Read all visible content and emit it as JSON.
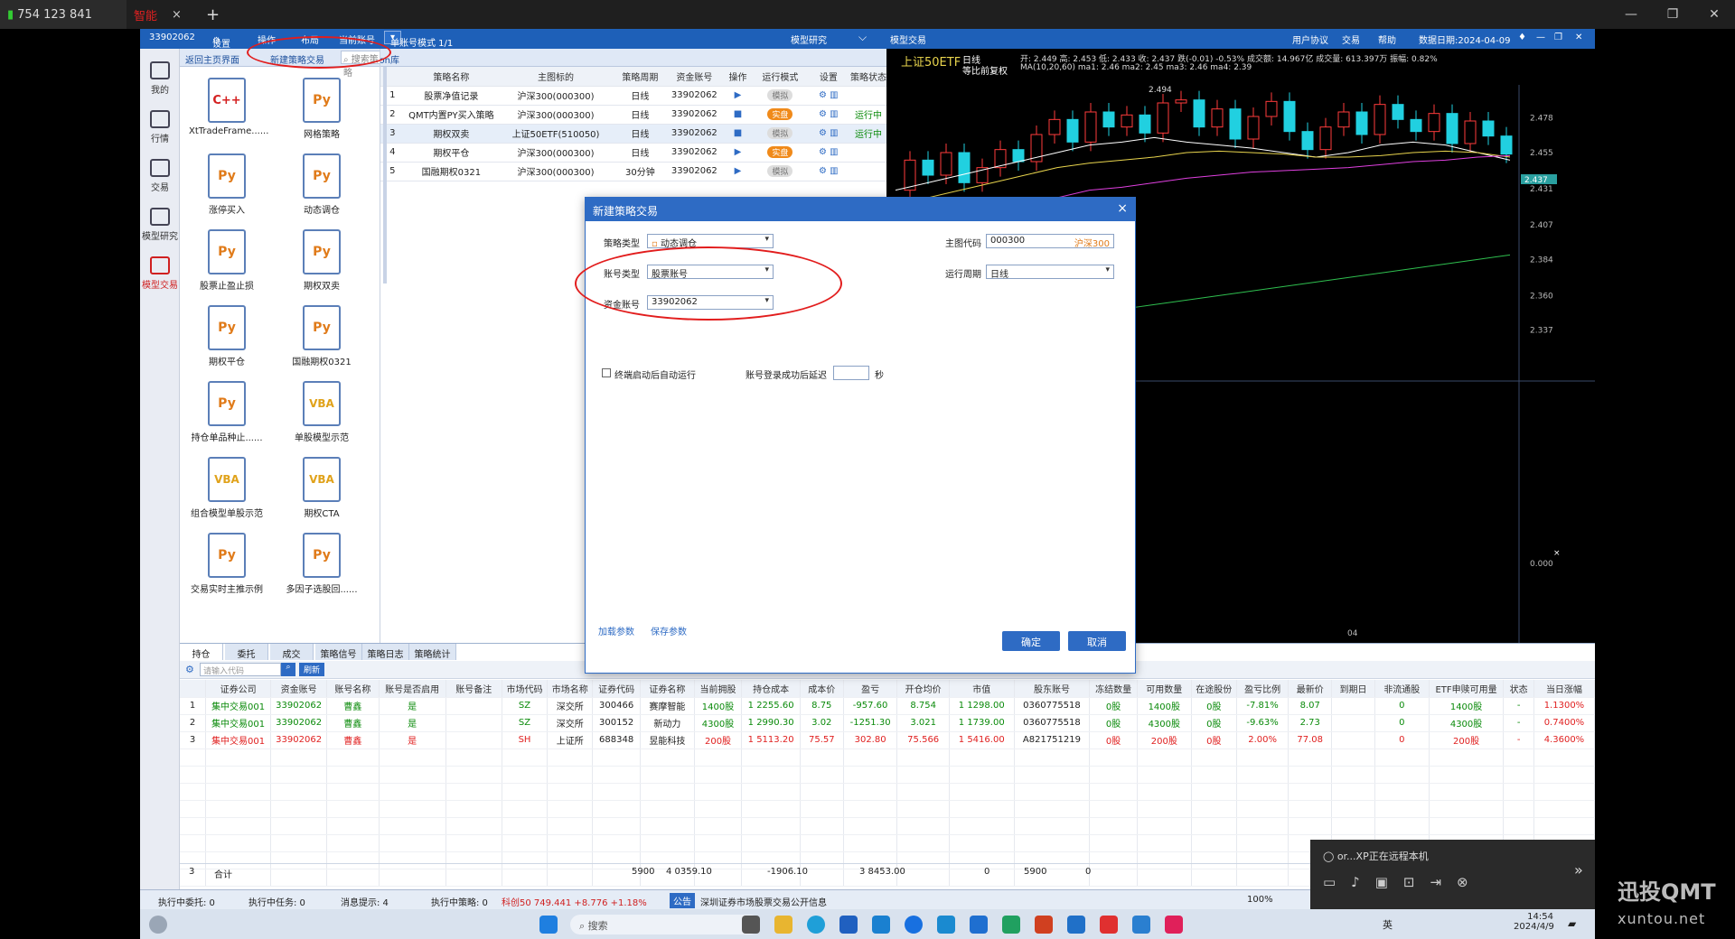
{
  "browser": {
    "tab1_label": "754 123 841",
    "tab2_label": "智能",
    "new_tab": "+"
  },
  "app": {
    "account_id": "33902062",
    "menu": [
      "设置",
      "操作",
      "布局",
      "当前账号"
    ],
    "account_mode": "单账号模式 1/1",
    "model_research": "模型研究",
    "model_trading": "模型交易",
    "user_agreement": "用户协议",
    "trade": "交易",
    "help": "帮助",
    "data_date": "数据日期:2024-04-09"
  },
  "left_nav": [
    {
      "label": "我的",
      "icon": "home-icon"
    },
    {
      "label": "行情",
      "icon": "chart-icon"
    },
    {
      "label": "交易",
      "icon": "trade-icon"
    },
    {
      "label": "模型研究",
      "icon": "model-research-icon"
    },
    {
      "label": "模型交易",
      "icon": "model-trading-icon"
    }
  ],
  "strategy_tabs": {
    "back_home": "返回主页界面",
    "new_strategy": "新建策略交易",
    "search_placeholder": "搜索策略",
    "download": "下载python库"
  },
  "strategy_files": [
    {
      "name": "XtTradeFrame......",
      "type": "C++"
    },
    {
      "name": "网格策略",
      "type": "Py"
    },
    {
      "name": "涨停买入",
      "type": "Py"
    },
    {
      "name": "动态调仓",
      "type": "Py"
    },
    {
      "name": "股票止盈止损",
      "type": "Py"
    },
    {
      "name": "期权双卖",
      "type": "Py"
    },
    {
      "name": "期权平仓",
      "type": "Py"
    },
    {
      "name": "国融期权0321",
      "type": "Py"
    },
    {
      "name": "持仓单品种止......",
      "type": "Py"
    },
    {
      "name": "单股模型示范",
      "type": "VBA"
    },
    {
      "name": "组合模型单股示范",
      "type": "VBA"
    },
    {
      "name": "期权CTA",
      "type": "VBA"
    },
    {
      "name": "交易实时主推示例",
      "type": "Py"
    },
    {
      "name": "多因子选股回......",
      "type": "Py"
    }
  ],
  "strategy_table": {
    "headers": [
      "",
      "策略名称",
      "主图标的",
      "策略周期",
      "资金账号",
      "操作",
      "运行模式",
      "设置",
      "策略状态"
    ],
    "rows": [
      {
        "idx": "1",
        "name": "股票净值记录",
        "target": "沪深300(000300)",
        "period": "日线",
        "account": "33902062",
        "op": "▶",
        "mode": "模拟",
        "status": ""
      },
      {
        "idx": "2",
        "name": "QMT内置PY买入策略",
        "target": "沪深300(000300)",
        "period": "日线",
        "account": "33902062",
        "op": "■",
        "mode": "实盘",
        "status": "运行中"
      },
      {
        "idx": "3",
        "name": "期权双卖",
        "target": "上证50ETF(510050)",
        "period": "日线",
        "account": "33902062",
        "op": "■",
        "mode": "模拟",
        "status": "运行中"
      },
      {
        "idx": "4",
        "name": "期权平仓",
        "target": "沪深300(000300)",
        "period": "日线",
        "account": "33902062",
        "op": "▶",
        "mode": "实盘",
        "status": ""
      },
      {
        "idx": "5",
        "name": "国融期权0321",
        "target": "沪深300(000300)",
        "period": "30分钟",
        "account": "33902062",
        "op": "▶",
        "mode": "模拟",
        "status": ""
      }
    ]
  },
  "chart": {
    "symbol": "上证50ETF",
    "period": "日线",
    "adjust": "等比前复权",
    "ohlc_text": "开: 2.449  高: 2.453  低: 2.433  收: 2.437  跌(-0.01)  -0.53%  成交额: 14.967亿  成交量: 613.397万  振幅: 0.82%",
    "ma_text": "MA(10,20,60)  ma1: 2.46  ma2: 2.45  ma3: 2.46  ma4: 2.39",
    "price_labels": [
      "2.478",
      "2.455",
      "2.431",
      "2.407",
      "2.384",
      "2.360",
      "2.337",
      "0.000"
    ],
    "high_label": "2.494",
    "current_price": "2.437",
    "x_label": "04"
  },
  "chart_data": {
    "type": "line",
    "title": "上证50ETF",
    "series": [
      {
        "name": "ma1",
        "color": "#ffffff",
        "values": [
          2.43,
          2.435,
          2.44,
          2.445,
          2.45,
          2.455,
          2.46,
          2.462,
          2.465,
          2.462,
          2.46,
          2.458,
          2.455,
          2.452,
          2.455,
          2.46,
          2.462,
          2.46,
          2.455,
          2.45
        ]
      },
      {
        "name": "ma2",
        "color": "#e8d44d",
        "values": [
          2.42,
          2.425,
          2.43,
          2.435,
          2.44,
          2.445,
          2.448,
          2.45,
          2.452,
          2.455,
          2.456,
          2.455,
          2.454,
          2.452,
          2.452,
          2.453,
          2.455,
          2.456,
          2.455,
          2.452
        ]
      },
      {
        "name": "ma3",
        "color": "#e040e0",
        "values": [
          2.4,
          2.405,
          2.41,
          2.415,
          2.42,
          2.425,
          2.43,
          2.432,
          2.435,
          2.438,
          2.44,
          2.442,
          2.443,
          2.444,
          2.445,
          2.447,
          2.449,
          2.45,
          2.452,
          2.453
        ]
      },
      {
        "name": "ma4",
        "color": "#2fbf4f",
        "values": [
          2.33,
          2.333,
          2.336,
          2.339,
          2.342,
          2.345,
          2.348,
          2.351,
          2.354,
          2.357,
          2.36,
          2.363,
          2.366,
          2.369,
          2.372,
          2.375,
          2.378,
          2.381,
          2.384,
          2.387
        ]
      }
    ],
    "ylim": [
      2.32,
      2.5
    ]
  },
  "dialog": {
    "title": "新建策略交易",
    "strategy_type_label": "策略类型",
    "strategy_type_value": "动态调仓",
    "account_type_label": "账号类型",
    "account_type_value": "股票账号",
    "fund_account_label": "资金账号",
    "fund_account_value": "33902062",
    "main_code_label": "主图代码",
    "main_code_value": "000300",
    "main_code_name": "沪深300",
    "run_period_label": "运行周期",
    "run_period_value": "日线",
    "auto_run_label": "终端启动后自动运行",
    "login_delay_label": "账号登录成功后延迟",
    "login_delay_value": "",
    "seconds_label": "秒",
    "load_params": "加载参数",
    "save_params": "保存参数",
    "ok": "确定",
    "cancel": "取消",
    "close": "×"
  },
  "bottom_tabs": [
    "持仓",
    "委托",
    "成交",
    "策略信号",
    "策略日志",
    "策略统计"
  ],
  "bottom_search_placeholder": "请输入代码",
  "bottom_refresh": "刷新",
  "holdings_headers": [
    "",
    "证券公司",
    "资金账号",
    "账号名称",
    "账号是否启用",
    "账号备注",
    "市场代码",
    "市场名称",
    "证券代码",
    "证券名称",
    "当前拥股",
    "持仓成本",
    "成本价",
    "盈亏",
    "开仓均价",
    "市值",
    "股东账号",
    "冻结数量",
    "可用数量",
    "在途股份",
    "盈亏比例",
    "最新价",
    "到期日",
    "非流通股",
    "ETF申赎可用量",
    "状态",
    "当日涨幅"
  ],
  "holdings": [
    [
      "1",
      "集中交易001",
      "33902062",
      "曹鑫",
      "是",
      "",
      "SZ",
      "深交所",
      "300466",
      "赛摩智能",
      "1400股",
      "1 2255.60",
      "8.75",
      "-957.60",
      "8.754",
      "1 1298.00",
      "0360775518",
      "0股",
      "1400股",
      "0股",
      "-7.81%",
      "8.07",
      "",
      "0",
      "1400股",
      "-",
      "1.1300%"
    ],
    [
      "2",
      "集中交易001",
      "33902062",
      "曹鑫",
      "是",
      "",
      "SZ",
      "深交所",
      "300152",
      "新动力",
      "4300股",
      "1 2990.30",
      "3.02",
      "-1251.30",
      "3.021",
      "1 1739.00",
      "0360775518",
      "0股",
      "4300股",
      "0股",
      "-9.63%",
      "2.73",
      "",
      "0",
      "4300股",
      "-",
      "0.7400%"
    ],
    [
      "3",
      "集中交易001",
      "33902062",
      "曹鑫",
      "是",
      "",
      "SH",
      "上证所",
      "688348",
      "昱能科技",
      "200股",
      "1 5113.20",
      "75.57",
      "302.80",
      "75.566",
      "1 5416.00",
      "A821751219",
      "0股",
      "200股",
      "0股",
      "2.00%",
      "77.08",
      "",
      "0",
      "200股",
      "-",
      "4.3600%"
    ]
  ],
  "totals": {
    "count": "3",
    "label": "合计",
    "hold": "5900",
    "cost": "4 0359.10",
    "pnl": "-1906.10",
    "value": "3 8453.00",
    "frozen": "0",
    "avail": "5900",
    "transit": "0"
  },
  "statusbar": {
    "exec_orders": "执行中委托: 0",
    "exec_tasks": "执行中任务: 0",
    "messages": "消息提示: 4",
    "exec_strategies": "执行中策略: 0",
    "index": "科创50  749.441  +8.776  +1.18%",
    "notice_tag": "公告",
    "notice": "深圳证券市场股票交易公开信息",
    "zoom": "100%"
  },
  "remote": {
    "title": "or...XP正在远程本机"
  },
  "taskbar": {
    "search": "搜索",
    "time": "14:54",
    "date": "2024/4/9",
    "lang": "英"
  },
  "watermark": {
    "line1": "迅投QMT",
    "line2": "xuntou.net"
  }
}
